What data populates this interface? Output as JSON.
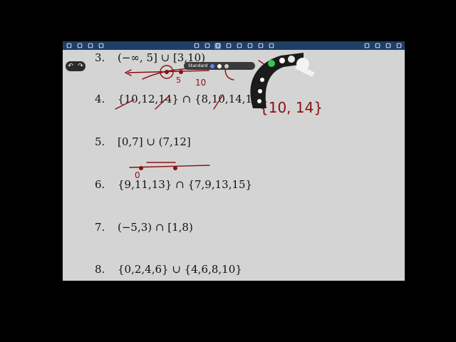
{
  "toolbar": {
    "left_icons": [
      "sidebar-icon",
      "search-icon",
      "share-icon",
      "bookmark-icon"
    ],
    "center_icons": [
      "pages-icon",
      "pen-icon",
      "highlighter-icon",
      "eraser-icon",
      "lasso-icon",
      "shapes-icon",
      "image-icon",
      "text-icon"
    ],
    "right_icons": [
      "export-icon",
      "add-page-icon",
      "grid-icon",
      "more-icon"
    ],
    "color": "#1f3f66"
  },
  "problems": [
    {
      "num": "3.",
      "expr": "(−∞, 5] ∪ [3,10)"
    },
    {
      "num": "4.",
      "expr": "{10,12,14} ∩ {8,10,14,16}"
    },
    {
      "num": "5.",
      "expr": "[0,7] ∪ (7,12]"
    },
    {
      "num": "6.",
      "expr": "{9,11,13} ∩ {7,9,13,15}"
    },
    {
      "num": "7.",
      "expr": "(−5,3) ∩ [1,8)"
    },
    {
      "num": "8.",
      "expr": "{0,2,4,6} ∪ {4,6,8,10}"
    }
  ],
  "handwriting": {
    "answer4": "{10, 14}",
    "label5": "5",
    "label10": "10",
    "label0": "0",
    "ink_color": "#8b1010"
  },
  "pen_panel": {
    "label": "Standard",
    "colors": [
      "#ffffff",
      "#cfcfcf",
      "#5b86ff"
    ]
  },
  "undo": {
    "undo_symbol": "↶",
    "redo_symbol": "↷"
  }
}
